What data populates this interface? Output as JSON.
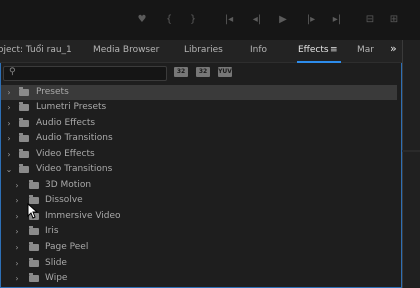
{
  "transport": {
    "buttons": [
      "marker-icon",
      "in-point-icon",
      "out-point-icon",
      "go-to-in-icon",
      "step-back-icon",
      "play-icon",
      "step-forward-icon",
      "go-to-out-icon",
      "insert-icon",
      "overwrite-icon"
    ]
  },
  "tabs": {
    "project": "oject: Tuổi rau_1",
    "media_browser": "Media Browser",
    "libraries": "Libraries",
    "info": "Info",
    "effects": "Effects",
    "effects_menu": "≡",
    "markers": "Mar",
    "more": "»"
  },
  "search": {
    "value": "",
    "placeholder": ""
  },
  "filter_buttons": [
    "32",
    "32",
    "YUV"
  ],
  "tree": [
    {
      "label": "Presets",
      "expanded": false,
      "selected": true
    },
    {
      "label": "Lumetri Presets",
      "expanded": false
    },
    {
      "label": "Audio Effects",
      "expanded": false
    },
    {
      "label": "Audio Transitions",
      "expanded": false
    },
    {
      "label": "Video Effects",
      "expanded": false
    },
    {
      "label": "Video Transitions",
      "expanded": true
    },
    {
      "label": "3D Motion",
      "expanded": false
    },
    {
      "label": "Dissolve",
      "expanded": false
    },
    {
      "label": "Immersive Video",
      "expanded": false
    },
    {
      "label": "Iris",
      "expanded": false
    },
    {
      "label": "Page Peel",
      "expanded": false
    },
    {
      "label": "Slide",
      "expanded": false
    },
    {
      "label": "Wipe",
      "expanded": false
    }
  ],
  "colors": {
    "accent": "#2d8ceb",
    "panel_border": "#2d6fb5"
  }
}
